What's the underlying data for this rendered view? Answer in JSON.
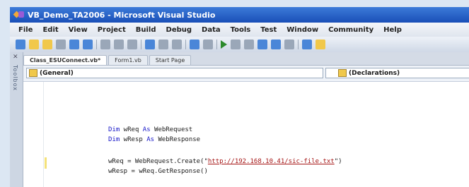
{
  "window": {
    "title": "VB_Demo_TA2006 - Microsoft Visual Studio"
  },
  "menu": [
    "File",
    "Edit",
    "View",
    "Project",
    "Build",
    "Debug",
    "Data",
    "Tools",
    "Test",
    "Window",
    "Community",
    "Help"
  ],
  "toolbox": {
    "label": "Toolbox"
  },
  "tabs": [
    {
      "label": "Class_ESUConnect.vb*",
      "active": true
    },
    {
      "label": "Form1.vb",
      "active": false
    },
    {
      "label": "Start Page",
      "active": false
    }
  ],
  "editor": {
    "left_dropdown": "(General)",
    "right_dropdown": "(Declarations)",
    "lines": {
      "l1": {
        "kw": "Dim",
        "name": " wReq ",
        "as": "As",
        "type": " WebRequest"
      },
      "l2": {
        "kw": "Dim",
        "name": " wResp ",
        "as": "As",
        "type": " WebResponse"
      },
      "l3": {
        "pre": "wReq = WebRequest.Create(\"",
        "url": "http://192.168.10.41/sic-file.txt",
        "post": "\")"
      },
      "l4": {
        "text": "wResp = wReq.GetResponse()"
      }
    }
  },
  "colors": {
    "titlebar": "#1a4fb8",
    "keyword": "#1515c8",
    "string": "#a51515"
  }
}
